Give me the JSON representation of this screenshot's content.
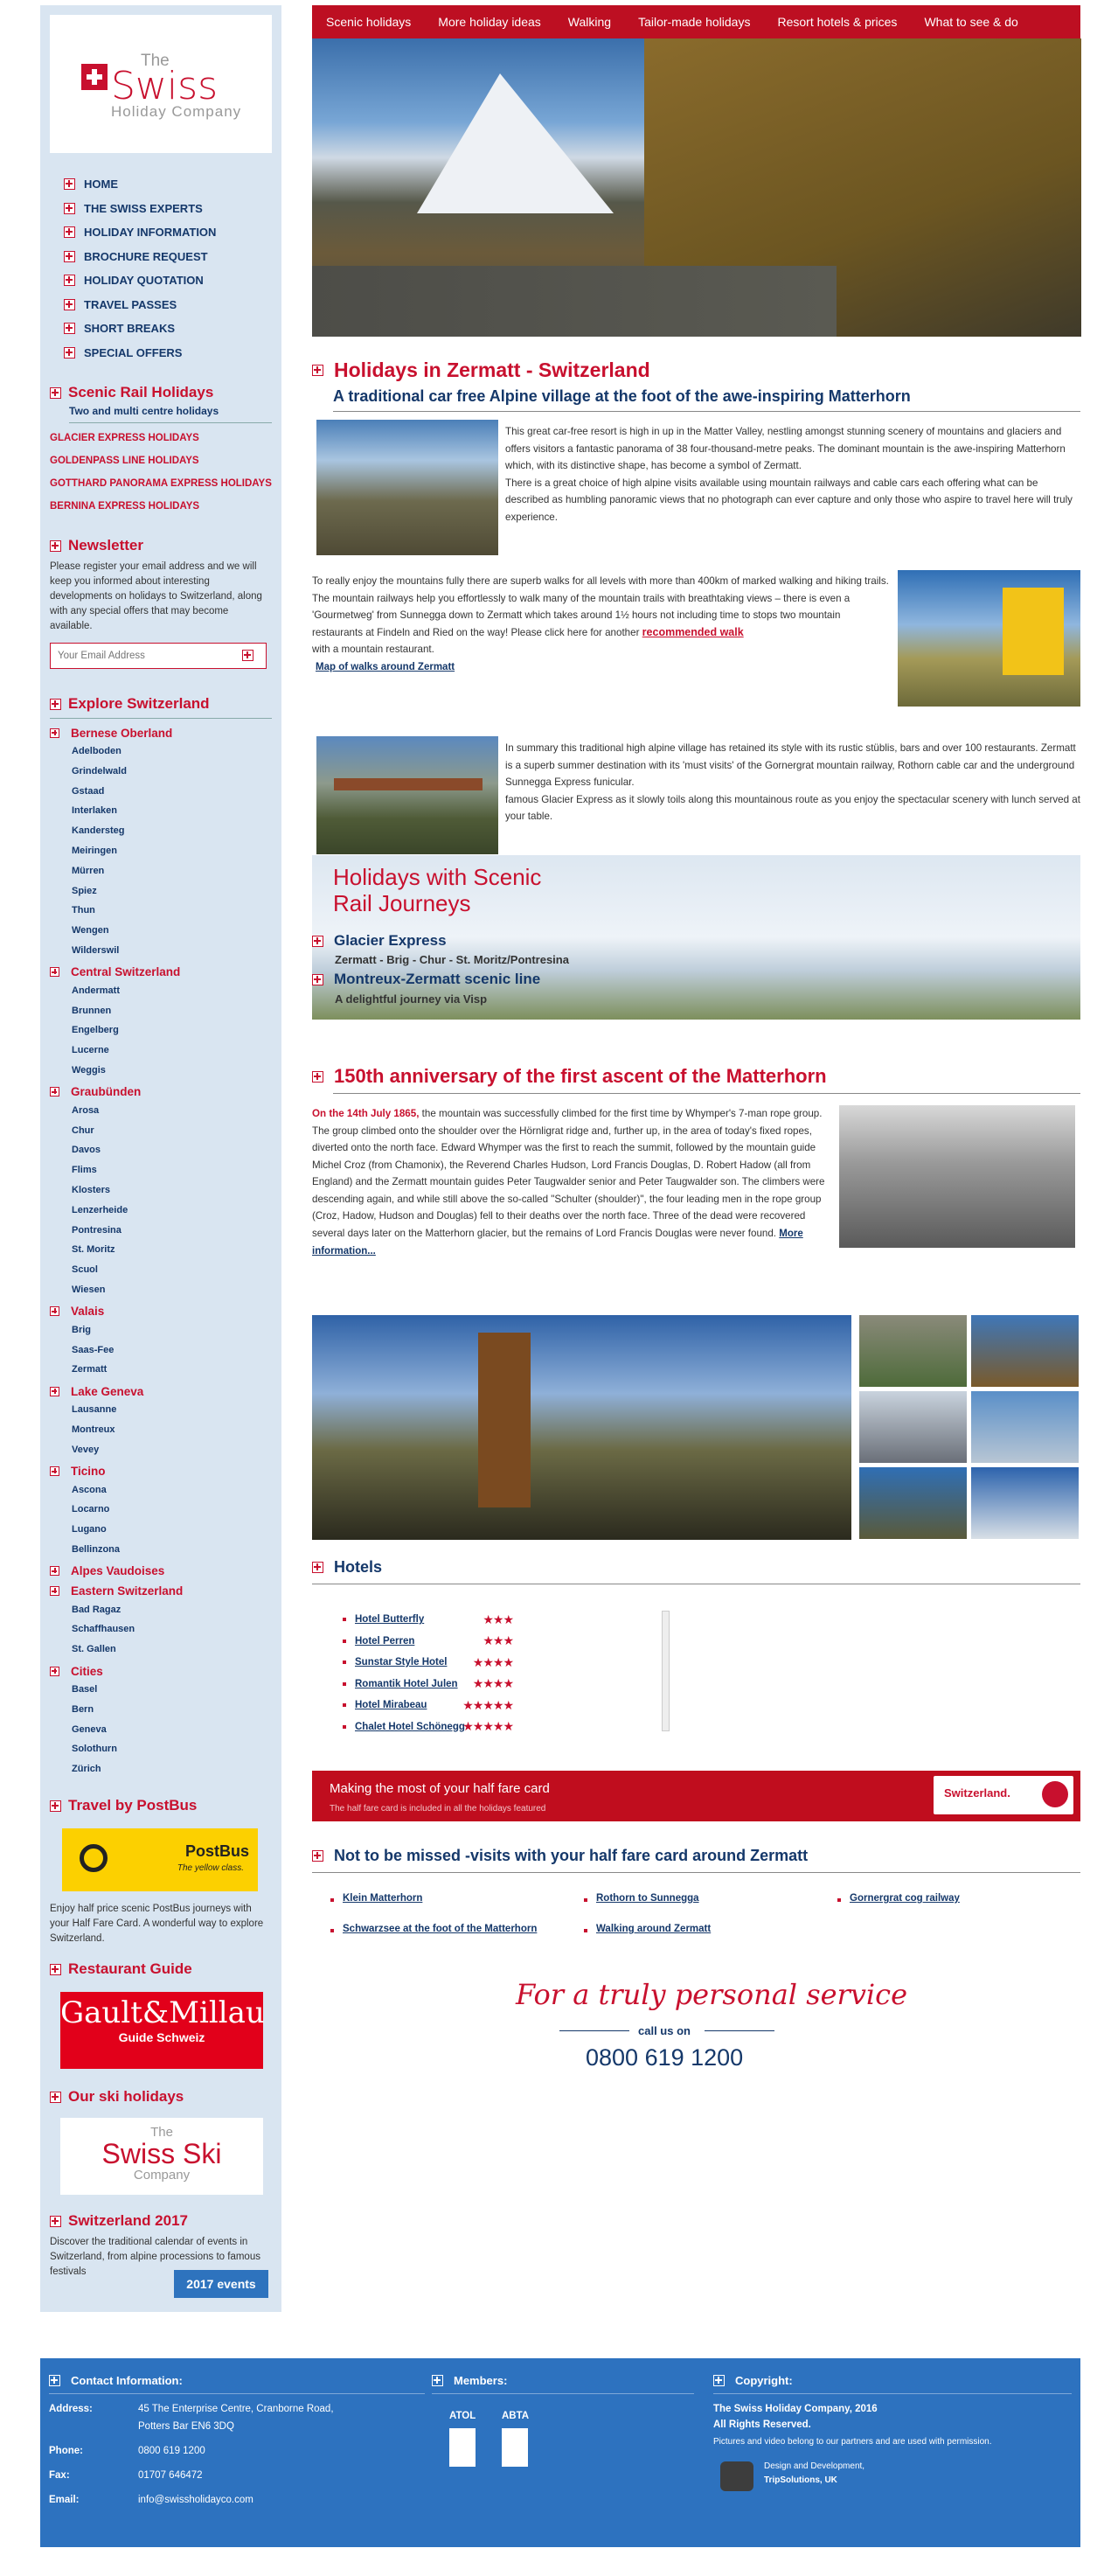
{
  "sidebar": {
    "logo": {
      "the": "The",
      "swiss": "Swiss",
      "company": "Holiday Company"
    },
    "menu": [
      "HOME",
      "THE SWISS EXPERTS",
      "HOLIDAY INFORMATION",
      "BROCHURE REQUEST",
      "HOLIDAY QUOTATION",
      "TRAVEL PASSES",
      "SHORT BREAKS",
      "SPECIAL OFFERS"
    ],
    "scenic": {
      "title": "Scenic Rail Holidays",
      "subtitle": "Two and multi centre holidays",
      "links": [
        "GLACIER EXPRESS HOLIDAYS",
        "GOLDENPASS LINE HOLIDAYS",
        "GOTTHARD PANORAMA EXPRESS HOLIDAYS",
        "BERNINA EXPRESS HOLIDAYS"
      ]
    },
    "newsletter": {
      "title": "Newsletter",
      "text": "Please register your email address and we will keep you informed about interesting developments on holidays to Switzerland, along with any special offers that may become available.",
      "placeholder": "Your Email Address"
    },
    "explore": {
      "title": "Explore Switzerland",
      "regions": [
        {
          "name": "Bernese Oberland",
          "towns": [
            "Adelboden",
            "Grindelwald",
            "Gstaad",
            "Interlaken",
            "Kandersteg",
            "Meiringen",
            "Mürren",
            "Spiez",
            "Thun",
            "Wengen",
            "Wilderswil"
          ]
        },
        {
          "name": "Central Switzerland",
          "towns": [
            "Andermatt",
            "Brunnen",
            "Engelberg",
            "Lucerne",
            "Weggis"
          ]
        },
        {
          "name": "Graubünden",
          "towns": [
            "Arosa",
            "Chur",
            "Davos",
            "Flims",
            "Klosters",
            "Lenzerheide",
            "Pontresina",
            "St. Moritz",
            "Scuol",
            "Wiesen"
          ]
        },
        {
          "name": "Valais",
          "towns": [
            "Brig",
            "Saas-Fee",
            "Zermatt"
          ]
        },
        {
          "name": "Lake Geneva",
          "towns": [
            "Lausanne",
            "Montreux",
            "Vevey"
          ]
        },
        {
          "name": "Ticino",
          "towns": [
            "Ascona",
            "Locarno",
            "Lugano",
            "Bellinzona"
          ]
        },
        {
          "name": "Alpes Vaudoises",
          "towns": []
        },
        {
          "name": "Eastern Switzerland",
          "towns": [
            "Bad Ragaz",
            "Schaffhausen",
            "St. Gallen"
          ]
        },
        {
          "name": "Cities",
          "towns": [
            "Basel",
            "Bern",
            "Geneva",
            "Solothurn",
            "Zürich"
          ]
        }
      ]
    },
    "postbus": {
      "title": "Travel by PostBus",
      "brand": "PostBus",
      "tagline": "The yellow class.",
      "text": "Enjoy half price scenic PostBus journeys with your Half Fare Card. A wonderful way to explore Switzerland."
    },
    "restaurant": {
      "title": "Restaurant Guide",
      "brand": "Gault&Millau",
      "sub": "Guide Schweiz"
    },
    "ski": {
      "title": "Our ski holidays",
      "the": "The",
      "swiss": "Swiss Ski",
      "company": "Company"
    },
    "events": {
      "title": "Switzerland 2017",
      "text": "Discover the traditional calendar of events in Switzerland, from alpine processions to famous festivals",
      "button": "2017 events"
    }
  },
  "nav": [
    "Scenic holidays",
    "More holiday ideas",
    "Walking",
    "Tailor-made holidays",
    "Resort hotels & prices",
    "What to see & do"
  ],
  "zermatt": {
    "title": "Holidays in Zermatt - Switzerland",
    "subtitle": "A traditional car free Alpine village at the foot of the awe-inspiring Matterhorn",
    "p1": "This great car-free resort is high in up in the Matter Valley, nestling amongst stunning scenery of mountains and glaciers and offers visitors a fantastic panorama of 38 four-thousand-metre peaks. The dominant mountain is the awe-inspiring Matterhorn which, with its distinctive shape, has become a symbol of Zermatt.",
    "p2": "There is a great choice of high alpine visits available using mountain railways and cable cars each offering what can be described as humbling panoramic views that no photograph can ever capture and only those who aspire to travel here will truly experience.",
    "p3": "To really enjoy the mountains fully there are superb walks for all levels with more than 400km of marked walking and hiking trails. The mountain railways help you effortlessly to walk many of the mountain trails with breathtaking views – there is even a 'Gourmetweg' from Sunnegga down to Zermatt which takes around 1½ hours not including time to stops two mountain restaurants at Findeln and Ried on the way! Please click here for another",
    "rec": "recommended walk",
    "p3b": "with a mountain restaurant.",
    "map": "Map of walks around Zermatt",
    "p4": "In summary this traditional high alpine village has retained its style with its rustic stüblis, bars and over 100 restaurants. Zermatt is a superb summer destination with its 'must visits' of the Gornergrat mountain railway, Rothorn cable car and the underground Sunnegga Express funicular.",
    "p5": "famous Glacier Express as it slowly toils along this mountainous route as you enjoy the spectacular scenery with lunch served at your table."
  },
  "scenicbanner": {
    "title1": "Holidays with Scenic",
    "title2": "Rail Journeys",
    "g1": "Glacier Express",
    "g1s": "Zermatt - Brig - Chur - St. Moritz/Pontresina",
    "g2": "Montreux-Zermatt scenic line",
    "g2s": "A delightful journey via Visp"
  },
  "anniv": {
    "title": "150th anniversary of the first ascent of the Matterhorn",
    "date": "On the 14th July 1865,",
    "text": "the mountain was successfully climbed for the first time by Whymper's 7-man rope group. The group climbed onto the shoulder over the Hörnligrat ridge and, further up, in the area of today's fixed ropes, diverted onto the north face. Edward Whymper was the first to reach the summit, followed by the mountain guide Michel Croz (from Chamonix), the Reverend Charles Hudson, Lord Francis Douglas, D. Robert Hadow (all from England) and the Zermatt mountain guides Peter Taugwalder senior and Peter Taugwalder son. The climbers were descending again, and while still above the so-called \"Schulter (shoulder)\", the four leading men in the rope group (Croz, Hadow, Hudson and Douglas) fell to their deaths over the north face. Three of the dead were recovered several days later on the Matterhorn glacier, but the remains of Lord Francis Douglas were never found.",
    "more": "More information..."
  },
  "hotels": {
    "title": "Hotels",
    "list": [
      {
        "name": "Hotel Butterfly",
        "stars": "★★★"
      },
      {
        "name": "Hotel Perren",
        "stars": "★★★"
      },
      {
        "name": "Sunstar Style Hotel",
        "stars": "★★★★"
      },
      {
        "name": "Romantik Hotel Julen",
        "stars": "★★★★"
      },
      {
        "name": "Hotel Mirabeau",
        "stars": "★★★★★"
      },
      {
        "name": "Chalet Hotel Schönegg",
        "stars": "★★★★★"
      }
    ]
  },
  "halffare": {
    "title": "Making the most of your half fare card",
    "text": "The half fare card is included in all the holidays featured",
    "brand": "Switzerland."
  },
  "notmissed": {
    "title": "Not to be missed -visits with your half fare card around Zermatt",
    "links": [
      "Klein Matterhorn",
      "Rothorn to Sunnegga",
      "Gornergrat cog railway",
      "Schwarzsee at the foot of the Matterhorn",
      "Walking around Zermatt"
    ]
  },
  "personal": {
    "title": "For a truly personal service",
    "call": "call us on",
    "phone": "0800 619 1200"
  },
  "footer": {
    "contact": {
      "title": "Contact Information:",
      "address_label": "Address:",
      "address1": "45 The Enterprise Centre, Cranborne Road,",
      "address2": "Potters Bar EN6 3DQ",
      "phone_label": "Phone:",
      "phone": "0800 619 1200",
      "fax_label": "Fax:",
      "fax": "01707 646472",
      "email_label": "Email:",
      "email": "info@swissholidayco.com"
    },
    "members": {
      "title": "Members:",
      "m1": "ATOL",
      "m2": "ABTA"
    },
    "copyright": {
      "title": "Copyright:",
      "l1": "The Swiss Holiday Company, 2016",
      "l2": "All Rights Reserved.",
      "l3": "Pictures and video belong to our partners and are used with permission.",
      "d1": "Design and Development,",
      "d2": "TripSolutions, UK"
    }
  }
}
